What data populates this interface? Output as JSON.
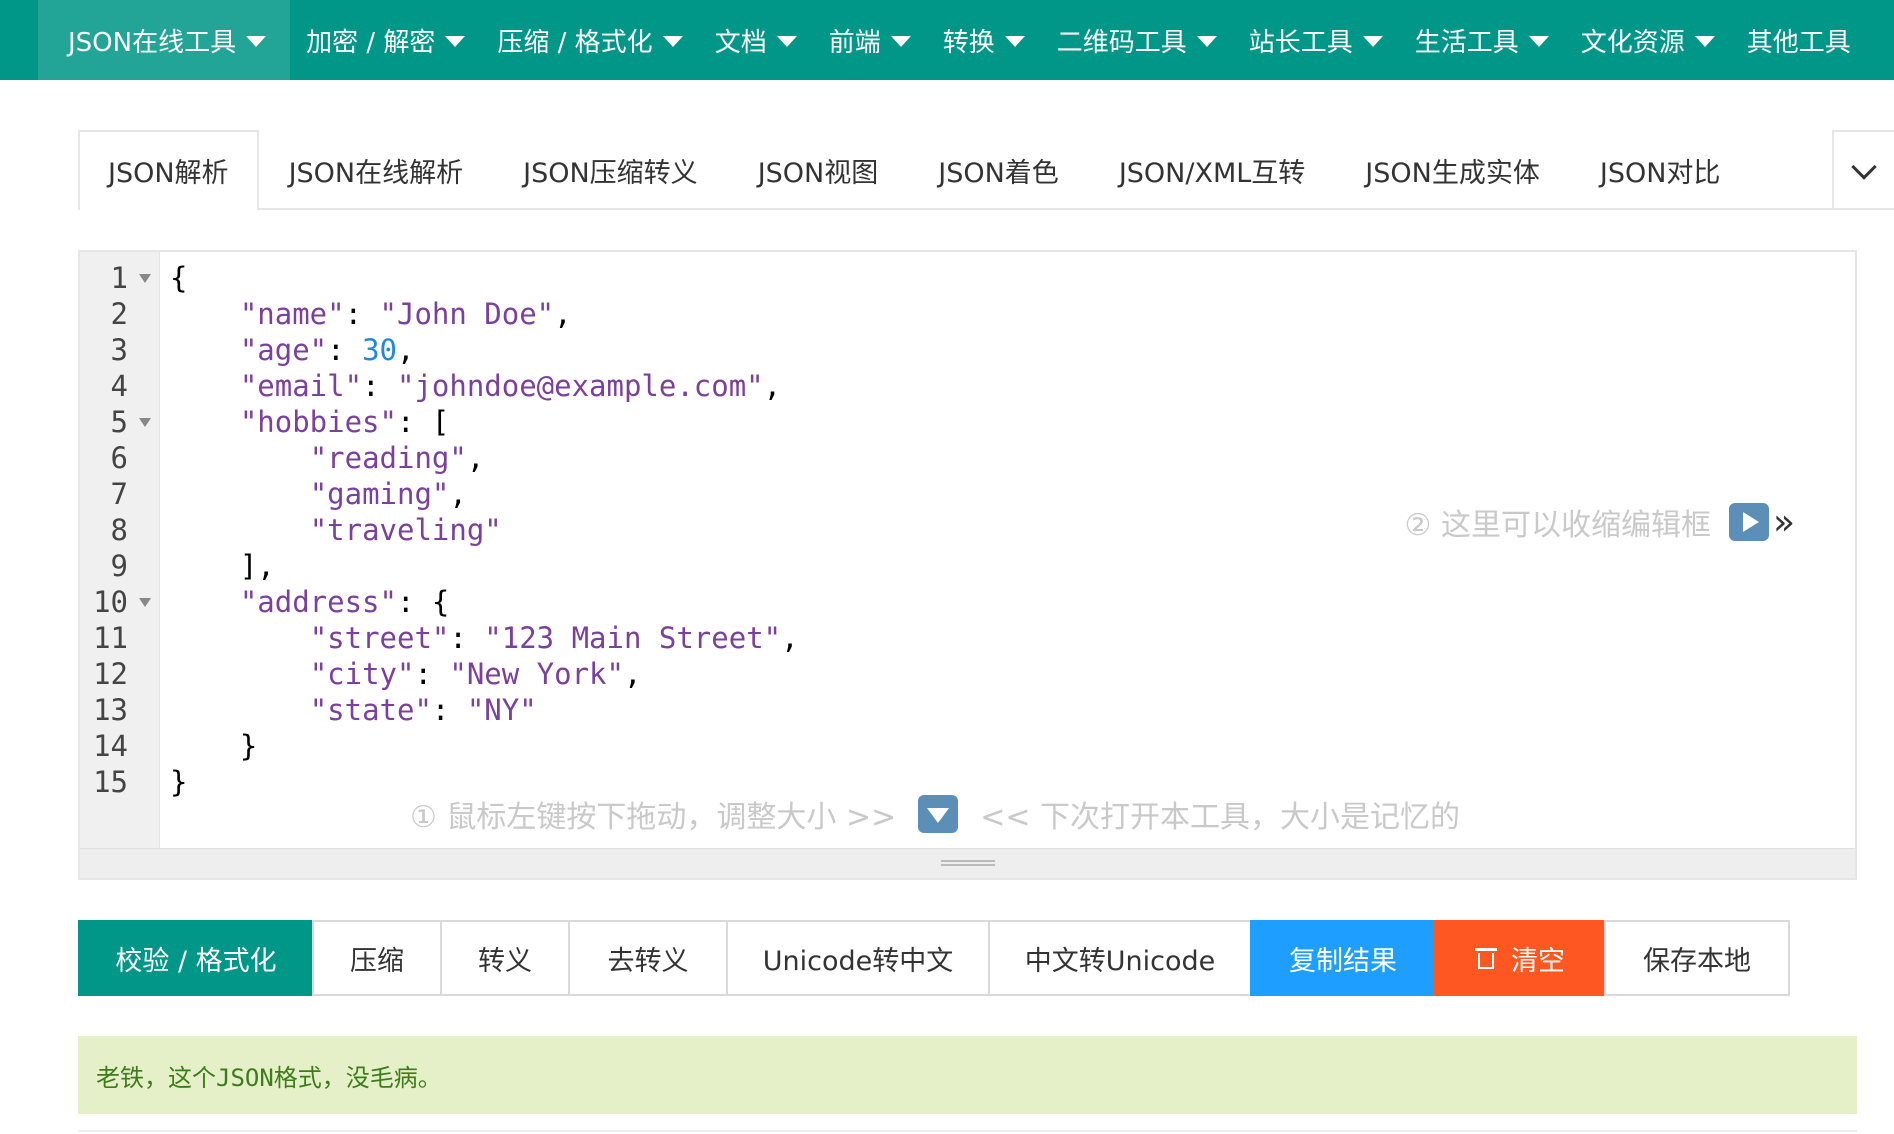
{
  "nav": {
    "items": [
      {
        "label": "JSON在线工具"
      },
      {
        "label": "加密 / 解密"
      },
      {
        "label": "压缩 / 格式化"
      },
      {
        "label": "文档"
      },
      {
        "label": "前端"
      },
      {
        "label": "转换"
      },
      {
        "label": "二维码工具"
      },
      {
        "label": "站长工具"
      },
      {
        "label": "生活工具"
      },
      {
        "label": "文化资源"
      },
      {
        "label": "其他工具"
      }
    ]
  },
  "tabs": {
    "items": [
      {
        "label": "JSON解析"
      },
      {
        "label": "JSON在线解析"
      },
      {
        "label": "JSON压缩转义"
      },
      {
        "label": "JSON视图"
      },
      {
        "label": "JSON着色"
      },
      {
        "label": "JSON/XML互转"
      },
      {
        "label": "JSON生成实体"
      },
      {
        "label": "JSON对比"
      }
    ]
  },
  "editor": {
    "line_numbers": [
      "1",
      "2",
      "3",
      "4",
      "5",
      "6",
      "7",
      "8",
      "9",
      "10",
      "11",
      "12",
      "13",
      "14",
      "15"
    ],
    "lines": [
      {
        "parts": [
          {
            "t": "{",
            "c": "p"
          }
        ]
      },
      {
        "parts": [
          {
            "t": "    ",
            "c": "p"
          },
          {
            "t": "\"name\"",
            "c": "k"
          },
          {
            "t": ": ",
            "c": "p"
          },
          {
            "t": "\"John Doe\"",
            "c": "s"
          },
          {
            "t": ",",
            "c": "p"
          }
        ]
      },
      {
        "parts": [
          {
            "t": "    ",
            "c": "p"
          },
          {
            "t": "\"age\"",
            "c": "k"
          },
          {
            "t": ": ",
            "c": "p"
          },
          {
            "t": "30",
            "c": "n"
          },
          {
            "t": ",",
            "c": "p"
          }
        ]
      },
      {
        "parts": [
          {
            "t": "    ",
            "c": "p"
          },
          {
            "t": "\"email\"",
            "c": "k"
          },
          {
            "t": ": ",
            "c": "p"
          },
          {
            "t": "\"johndoe@example.com\"",
            "c": "s"
          },
          {
            "t": ",",
            "c": "p"
          }
        ]
      },
      {
        "parts": [
          {
            "t": "    ",
            "c": "p"
          },
          {
            "t": "\"hobbies\"",
            "c": "k"
          },
          {
            "t": ": [",
            "c": "p"
          }
        ]
      },
      {
        "parts": [
          {
            "t": "        ",
            "c": "p"
          },
          {
            "t": "\"reading\"",
            "c": "s"
          },
          {
            "t": ",",
            "c": "p"
          }
        ]
      },
      {
        "parts": [
          {
            "t": "        ",
            "c": "p"
          },
          {
            "t": "\"gaming\"",
            "c": "s"
          },
          {
            "t": ",",
            "c": "p"
          }
        ]
      },
      {
        "parts": [
          {
            "t": "        ",
            "c": "p"
          },
          {
            "t": "\"traveling\"",
            "c": "s"
          }
        ]
      },
      {
        "parts": [
          {
            "t": "    ],",
            "c": "p"
          }
        ]
      },
      {
        "parts": [
          {
            "t": "    ",
            "c": "p"
          },
          {
            "t": "\"address\"",
            "c": "k"
          },
          {
            "t": ": {",
            "c": "p"
          }
        ]
      },
      {
        "parts": [
          {
            "t": "        ",
            "c": "p"
          },
          {
            "t": "\"street\"",
            "c": "k"
          },
          {
            "t": ": ",
            "c": "p"
          },
          {
            "t": "\"123 Main Street\"",
            "c": "s"
          },
          {
            "t": ",",
            "c": "p"
          }
        ]
      },
      {
        "parts": [
          {
            "t": "        ",
            "c": "p"
          },
          {
            "t": "\"city\"",
            "c": "k"
          },
          {
            "t": ": ",
            "c": "p"
          },
          {
            "t": "\"New York\"",
            "c": "s"
          },
          {
            "t": ",",
            "c": "p"
          }
        ]
      },
      {
        "parts": [
          {
            "t": "        ",
            "c": "p"
          },
          {
            "t": "\"state\"",
            "c": "k"
          },
          {
            "t": ": ",
            "c": "p"
          },
          {
            "t": "\"NY\"",
            "c": "s"
          }
        ]
      },
      {
        "parts": [
          {
            "t": "    }",
            "c": "p"
          }
        ]
      },
      {
        "parts": [
          {
            "t": "}",
            "c": "p"
          }
        ]
      }
    ],
    "hint_right": "② 这里可以收缩编辑框",
    "hint_bottom_left": "① 鼠标左键按下拖动，调整大小 >>",
    "hint_bottom_right": "<< 下次打开本工具，大小是记忆的"
  },
  "actions": {
    "validate_format": "校验 / 格式化",
    "compress": "压缩",
    "escape": "转义",
    "unescape": "去转义",
    "unicode_to_cn": "Unicode转中文",
    "cn_to_unicode": "中文转Unicode",
    "copy_result": "复制结果",
    "clear": "清空",
    "save_local": "保存本地"
  },
  "status": {
    "message": "老铁，这个JSON格式，没毛病。"
  },
  "colors": {
    "primary": "#009688",
    "blue": "#1e9fff",
    "orange": "#ff5722",
    "success_bg": "#e6f0c8"
  }
}
